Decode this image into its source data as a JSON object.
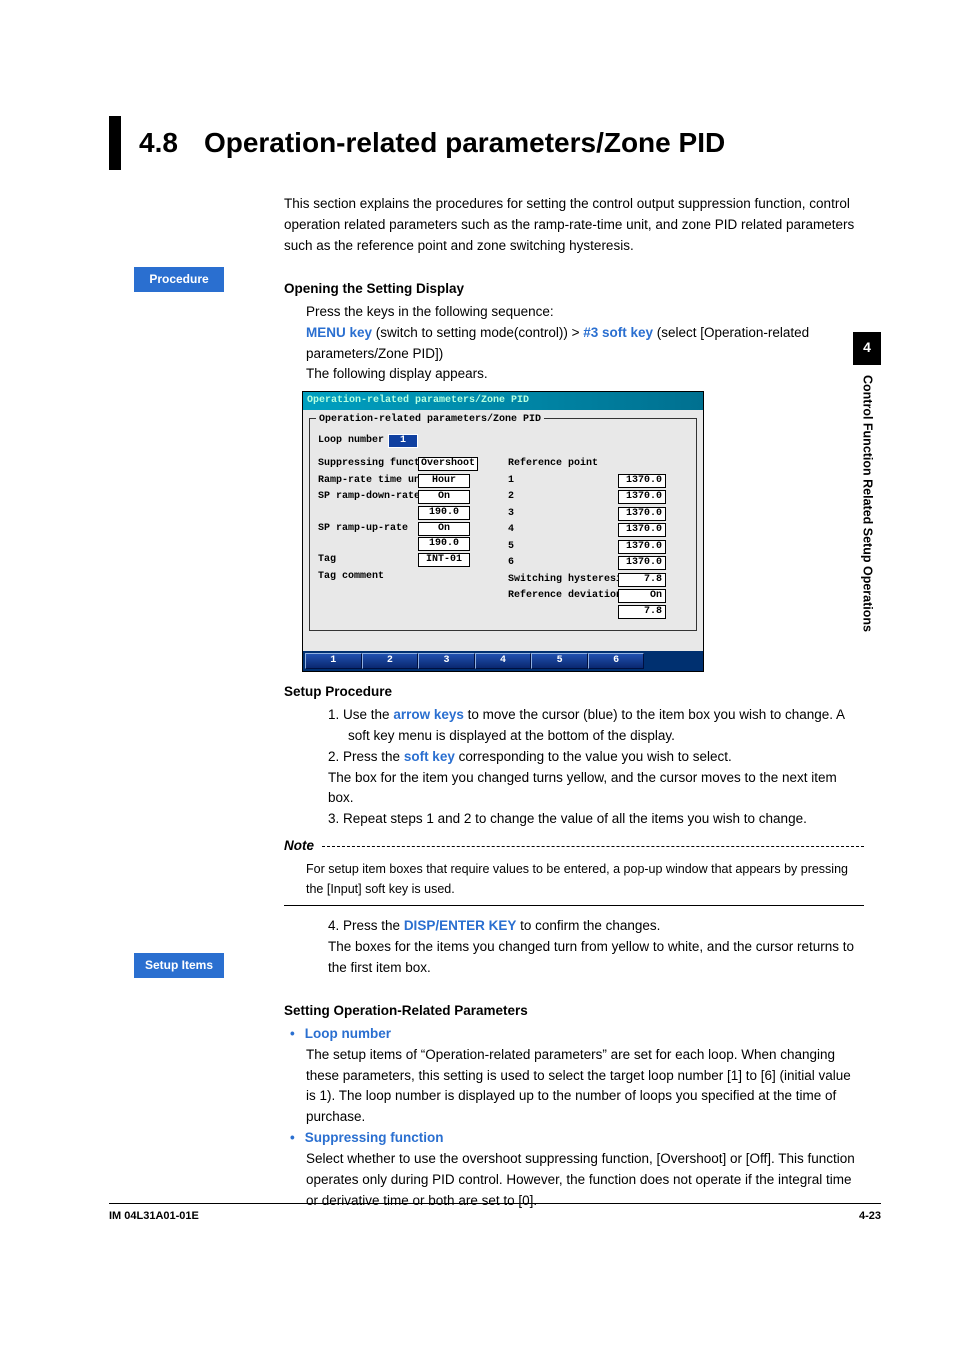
{
  "header": {
    "number": "4.8",
    "title": "Operation-related parameters/Zone PID"
  },
  "side_tab": {
    "num": "4",
    "text": "Control Function Related Setup Operations"
  },
  "badges": {
    "procedure": "Procedure",
    "setup_items": "Setup Items"
  },
  "intro": "This section explains the procedures for setting the control output suppression function, control operation related parameters such as the ramp-rate-time unit, and zone PID related parameters such as the reference point and zone switching hysteresis.",
  "opening": {
    "heading": "Opening the Setting Display",
    "line1": "Press the keys in the following sequence:",
    "menu_key": "MENU key",
    "menu_key_after": " (switch to setting mode(control)) > ",
    "soft_key": "#3 soft key",
    "soft_key_after": " (select [Operation-related parameters/Zone PID])",
    "line3": "The following display appears."
  },
  "screenshot": {
    "titlebar": "Operation-related parameters/Zone PID",
    "legend": "Operation-related parameters/Zone PID",
    "loop_label": "Loop number",
    "loop_value": "1",
    "left_rows": [
      {
        "label": "Suppressing function",
        "val": "Overshoot"
      },
      {
        "label": "Ramp-rate time unit",
        "val": "Hour"
      },
      {
        "label": "SP ramp-down-rate",
        "val": "On"
      },
      {
        "label": "",
        "val": "190.0"
      },
      {
        "label": "SP ramp-up-rate",
        "val": "On"
      },
      {
        "label": "",
        "val": "190.0"
      },
      {
        "label": "Tag",
        "val": "INT-01"
      },
      {
        "label": "Tag comment",
        "val": ""
      }
    ],
    "right_header": "Reference point",
    "right_rows": [
      {
        "label": "1",
        "val": "1370.0"
      },
      {
        "label": "2",
        "val": "1370.0"
      },
      {
        "label": "3",
        "val": "1370.0"
      },
      {
        "label": "4",
        "val": "1370.0"
      },
      {
        "label": "5",
        "val": "1370.0"
      },
      {
        "label": "6",
        "val": "1370.0"
      },
      {
        "label": "Switching hysteresis",
        "val": "7.8"
      },
      {
        "label": "Reference deviation",
        "val": "On"
      },
      {
        "label": "",
        "val": "7.8"
      }
    ],
    "softkeys": [
      "1",
      "2",
      "3",
      "4",
      "5",
      "6",
      ""
    ]
  },
  "setup_proc": {
    "heading": "Setup Procedure",
    "items": [
      {
        "n": "1.",
        "pre": "Use the ",
        "key": "arrow keys",
        "post": " to move the cursor (blue) to the item box you wish to change. A soft key menu is displayed at the bottom of the display."
      },
      {
        "n": "2.",
        "pre": "Press the ",
        "key": "soft key",
        "post": " corresponding to the value you wish to select.",
        "extra": "The box for the item you changed turns yellow, and the cursor moves to the next item box."
      },
      {
        "n": "3.",
        "pre": "Repeat steps 1 and 2 to change the value of all the items you wish to change.",
        "key": "",
        "post": ""
      }
    ]
  },
  "note": {
    "word": "Note",
    "text": "For setup item boxes that require values to be entered, a pop-up window that appears by pressing the [Input] soft key is used."
  },
  "step4": {
    "n": "4.",
    "pre": "Press the ",
    "key": "DISP/ENTER KEY",
    "post": " to confirm the changes.",
    "extra": "The boxes for the items you changed turn from yellow to white, and the cursor returns to the first item box."
  },
  "setting_params": {
    "heading": "Setting Operation-Related Parameters",
    "items": [
      {
        "title": "Loop number",
        "body": "The setup items of “Operation-related parameters” are set for each loop.  When changing these parameters, this setting is used to select the target loop number [1] to [6] (initial value is 1).  The loop number is displayed up to the number of loops you specified at the time of purchase."
      },
      {
        "title": "Suppressing function",
        "body": "Select whether to use the overshoot suppressing function, [Overshoot] or [Off].  This function operates only during PID control.  However, the function does not operate if the integral time or derivative time or both are set to [0]."
      }
    ]
  },
  "footer": {
    "left": "IM 04L31A01-01E",
    "right": "4-23"
  }
}
